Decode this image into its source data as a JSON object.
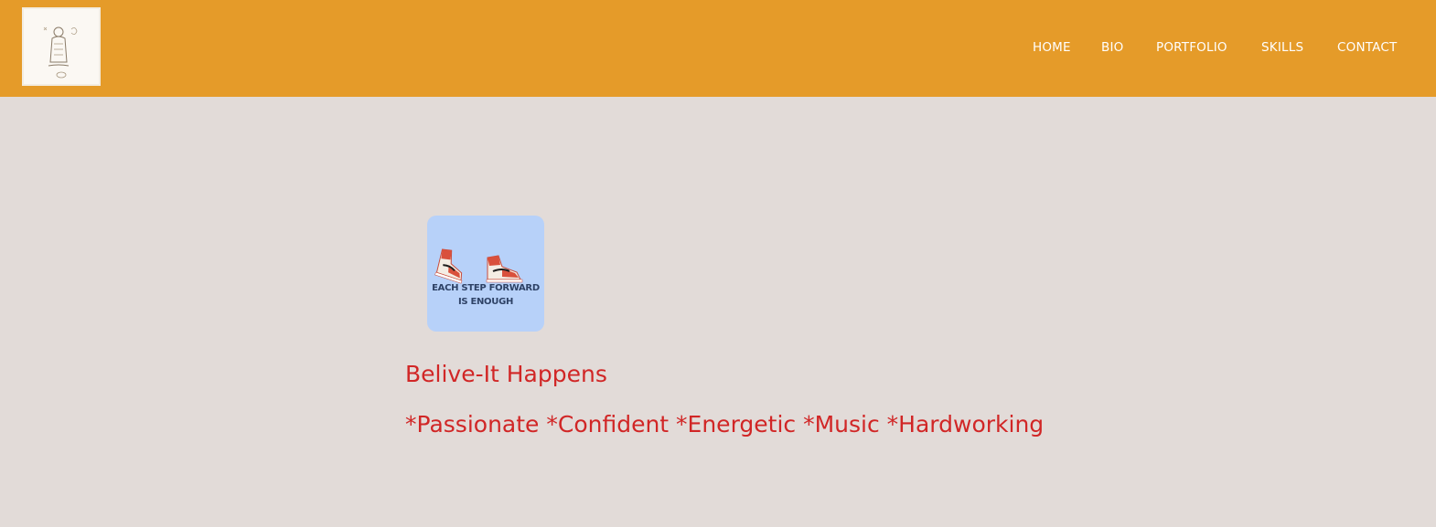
{
  "header": {
    "background_color": "#e59b29",
    "nav": [
      {
        "label": "HOME"
      },
      {
        "label": "BIO"
      },
      {
        "label": "PORTFOLIO"
      },
      {
        "label": "SKILLS"
      },
      {
        "label": "CONTACT"
      }
    ]
  },
  "hero": {
    "image_icon": "sneakers-icon",
    "image_caption_line1": "EACH STEP FORWARD",
    "image_caption_line2": "IS ENOUGH",
    "tagline": "Belive-It Happens",
    "traits": "*Passionate *Confident *Energetic *Music *Hardworking",
    "text_color": "#d12626",
    "page_background": "#e2dbd8"
  }
}
